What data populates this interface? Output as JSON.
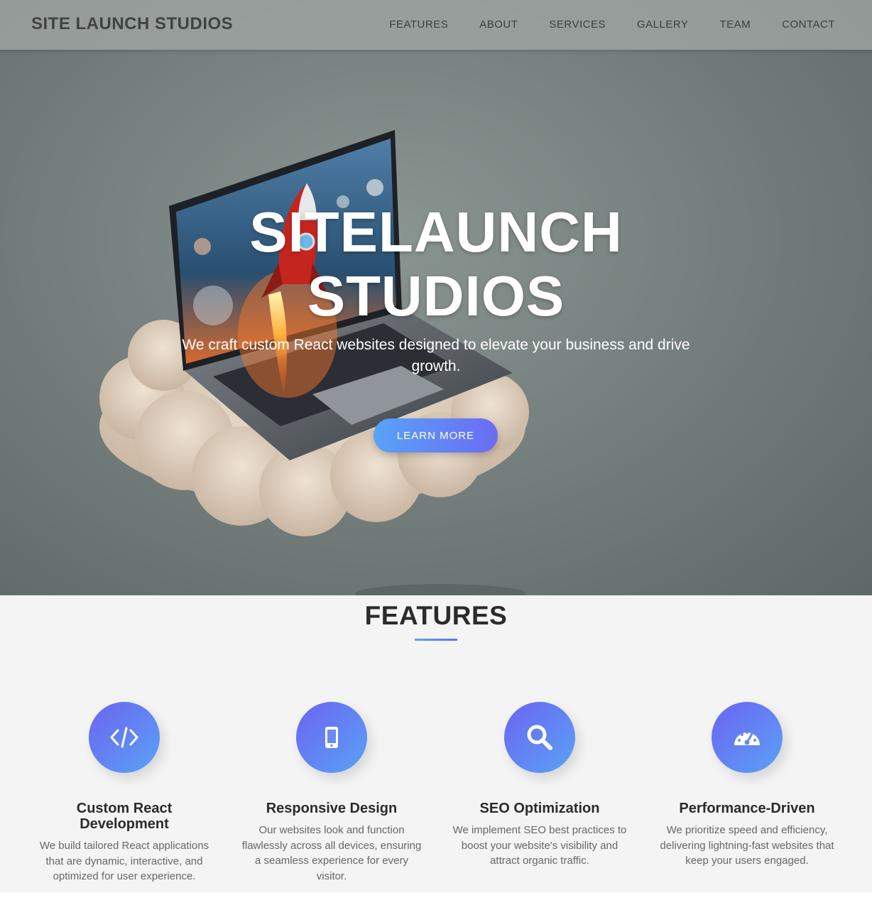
{
  "navbar": {
    "logo": "SITE LAUNCH STUDIOS",
    "links": [
      "FEATURES",
      "ABOUT",
      "SERVICES",
      "GALLERY",
      "TEAM",
      "CONTACT"
    ]
  },
  "hero": {
    "title_line1": "SITELAUNCH",
    "title_line2": "STUDIOS",
    "subtitle": "We craft custom React websites designed to elevate your business and drive growth.",
    "cta_label": "LEARN MORE",
    "image": "laptop-rocket-on-cloud"
  },
  "features": {
    "title": "FEATURES",
    "items": [
      {
        "icon": "code-icon",
        "title": "Custom React Development",
        "text": "We build tailored React applications that are dynamic, interactive, and optimized for user experience."
      },
      {
        "icon": "mobile-icon",
        "title": "Responsive Design",
        "text": "Our websites look and function flawlessly across all devices, ensuring a seamless experience for every visitor."
      },
      {
        "icon": "search-icon",
        "title": "SEO Optimization",
        "text": "We implement SEO best practices to boost your website's visibility and attract organic traffic."
      },
      {
        "icon": "speedometer-icon",
        "title": "Performance-Driven",
        "text": "We prioritize speed and efficiency, delivering lightning-fast websites that keep your users engaged."
      }
    ]
  },
  "colors": {
    "accent_start": "#5aa2f6",
    "accent_end": "#6a6cf3",
    "hero_bg": "#76807e",
    "features_bg": "#f4f4f4"
  }
}
